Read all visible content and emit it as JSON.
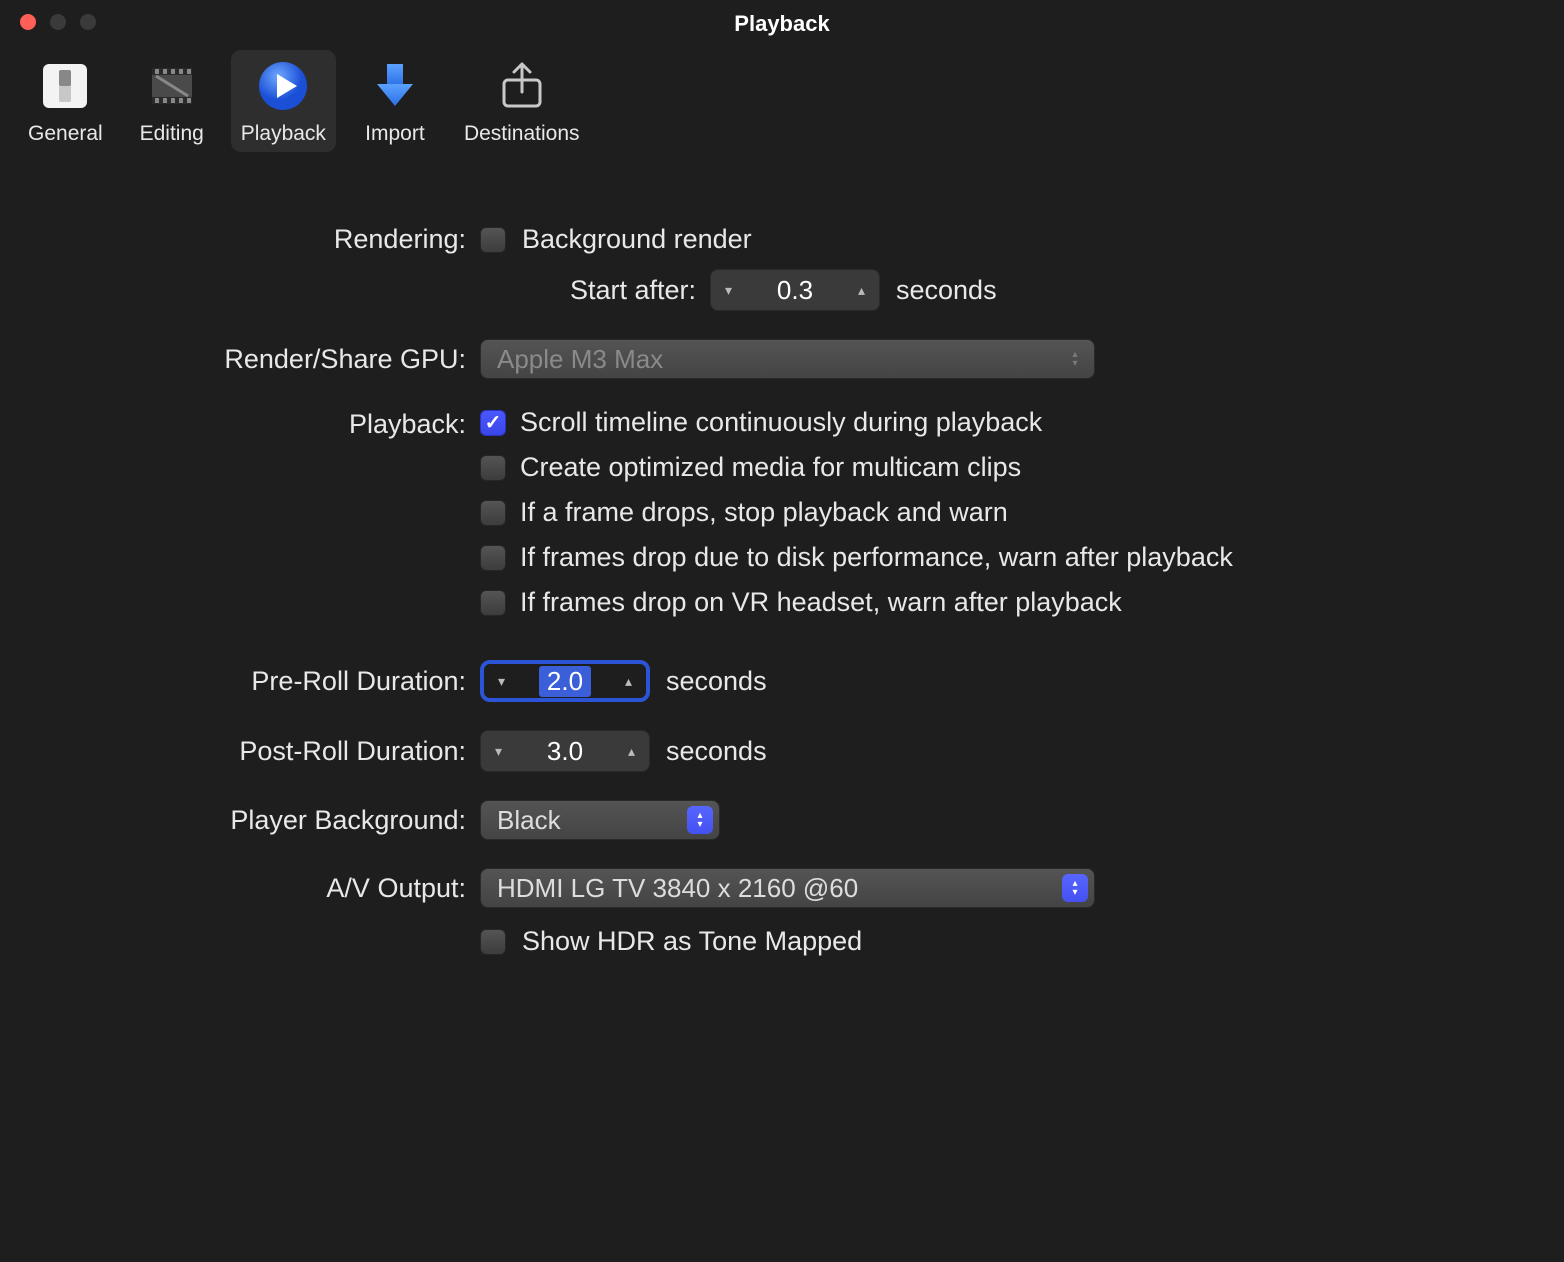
{
  "window": {
    "title": "Playback"
  },
  "toolbar": {
    "items": [
      {
        "id": "general",
        "label": "General"
      },
      {
        "id": "editing",
        "label": "Editing"
      },
      {
        "id": "playback",
        "label": "Playback"
      },
      {
        "id": "import",
        "label": "Import"
      },
      {
        "id": "destinations",
        "label": "Destinations"
      }
    ],
    "active": "playback"
  },
  "sections": {
    "rendering": {
      "label": "Rendering:",
      "background_render": {
        "checked": false,
        "label": "Background render"
      },
      "start_after": {
        "label": "Start after:",
        "value": "0.3",
        "unit": "seconds"
      }
    },
    "gpu": {
      "label": "Render/Share GPU:",
      "value": "Apple M3 Max",
      "disabled": true
    },
    "playback": {
      "label": "Playback:",
      "options": [
        {
          "checked": true,
          "label": "Scroll timeline continuously during playback"
        },
        {
          "checked": false,
          "label": "Create optimized media for multicam clips"
        },
        {
          "checked": false,
          "label": "If a frame drops, stop playback and warn"
        },
        {
          "checked": false,
          "label": "If frames drop due to disk performance, warn after playback"
        },
        {
          "checked": false,
          "label": "If frames drop on VR headset, warn after playback"
        }
      ]
    },
    "pre_roll": {
      "label": "Pre-Roll Duration:",
      "value": "2.0",
      "unit": "seconds",
      "focused": true
    },
    "post_roll": {
      "label": "Post-Roll Duration:",
      "value": "3.0",
      "unit": "seconds"
    },
    "player_bg": {
      "label": "Player Background:",
      "value": "Black"
    },
    "av_output": {
      "label": "A/V Output:",
      "value": "HDMI LG TV 3840 x 2160 @60",
      "hdr": {
        "checked": false,
        "label": "Show HDR as Tone Mapped"
      }
    }
  }
}
